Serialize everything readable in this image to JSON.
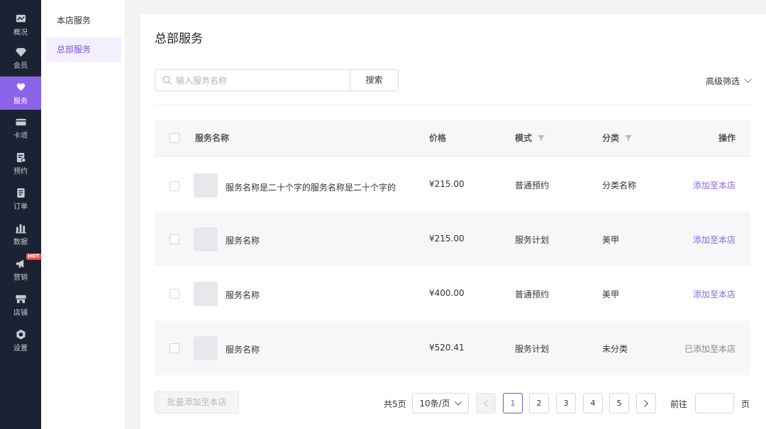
{
  "nav": {
    "items": [
      {
        "label": "概况",
        "icon": "overview-icon"
      },
      {
        "label": "会员",
        "icon": "diamond-icon"
      },
      {
        "label": "服务",
        "icon": "service-icon"
      },
      {
        "label": "卡项",
        "icon": "card-icon"
      },
      {
        "label": "预约",
        "icon": "appointment-icon"
      },
      {
        "label": "订单",
        "icon": "order-icon"
      },
      {
        "label": "数据",
        "icon": "bar-chart-icon"
      },
      {
        "label": "营销",
        "icon": "megaphone-icon"
      },
      {
        "label": "店铺",
        "icon": "store-icon"
      },
      {
        "label": "设置",
        "icon": "gear-icon"
      }
    ],
    "active_index": 2,
    "hot_badge": "HOT"
  },
  "submenu": {
    "items": [
      {
        "label": "本店服务"
      },
      {
        "label": "总部服务"
      }
    ],
    "active_index": 1
  },
  "page": {
    "title": "总部服务",
    "search_placeholder": "输入服务名称",
    "search_button": "搜索",
    "advanced_filter": "高级筛选"
  },
  "table": {
    "headers": {
      "name": "服务名称",
      "price": "价格",
      "mode": "模式",
      "category": "分类",
      "action": "操作"
    },
    "rows": [
      {
        "name": "服务名称是二十个字的服务名称是二十个字的",
        "price": "¥215.00",
        "mode": "普通预约",
        "category": "分类名称",
        "action": "添加至本店",
        "added": false
      },
      {
        "name": "服务名称",
        "price": "¥215.00",
        "mode": "服务计划",
        "category": "美甲",
        "action": "添加至本店",
        "added": false
      },
      {
        "name": "服务名称",
        "price": "¥400.00",
        "mode": "普通预约",
        "category": "美甲",
        "action": "添加至本店",
        "added": false
      },
      {
        "name": "服务名称",
        "price": "¥520.41",
        "mode": "服务计划",
        "category": "未分类",
        "action": "已添加至本店",
        "added": true
      }
    ]
  },
  "footer": {
    "batch_button": "批量添加至本店",
    "total": "共5页",
    "page_size": "10条/页",
    "pages": [
      "1",
      "2",
      "3",
      "4",
      "5"
    ],
    "current_page": "1",
    "goto_label": "前往",
    "page_unit": "页"
  },
  "colors": {
    "accent": "#8b63e6",
    "rail_bg": "#1b2233",
    "hot_badge": "#ff4d4f"
  }
}
